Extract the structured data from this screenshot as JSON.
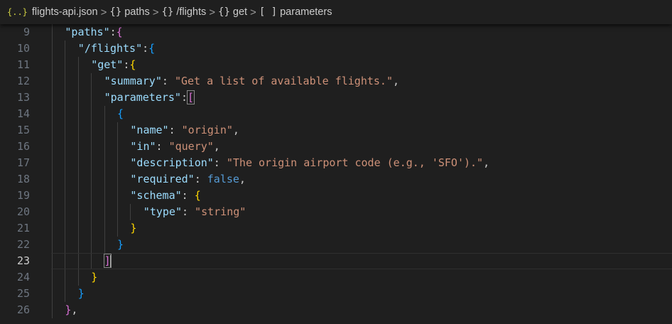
{
  "breadcrumb": [
    {
      "icon": "{..}",
      "icon_name": "json-file-icon",
      "label": "flights-api.json"
    },
    {
      "icon": "{}",
      "icon_name": "object-icon",
      "label": "paths"
    },
    {
      "icon": "{}",
      "icon_name": "object-icon",
      "label": "/flights"
    },
    {
      "icon": "{}",
      "icon_name": "object-icon",
      "label": "get"
    },
    {
      "icon": "[ ]",
      "icon_name": "array-icon",
      "label": "parameters"
    }
  ],
  "breadcrumb_separator": ">",
  "current_line": 23,
  "code": [
    {
      "n": "9",
      "indent": 2,
      "tokens": [
        {
          "t": "\"paths\"",
          "c": "key"
        },
        {
          "t": ":",
          "c": "p"
        },
        {
          "t": "{",
          "c": "b2"
        }
      ]
    },
    {
      "n": "10",
      "indent": 4,
      "tokens": [
        {
          "t": "\"/flights\"",
          "c": "key"
        },
        {
          "t": ":",
          "c": "p"
        },
        {
          "t": "{",
          "c": "b3"
        }
      ]
    },
    {
      "n": "11",
      "indent": 6,
      "tokens": [
        {
          "t": "\"get\"",
          "c": "key"
        },
        {
          "t": ":",
          "c": "p"
        },
        {
          "t": "{",
          "c": "b1"
        }
      ]
    },
    {
      "n": "12",
      "indent": 8,
      "tokens": [
        {
          "t": "\"summary\"",
          "c": "key"
        },
        {
          "t": ": ",
          "c": "p"
        },
        {
          "t": "\"Get a list of available flights.\"",
          "c": "str"
        },
        {
          "t": ",",
          "c": "p"
        }
      ]
    },
    {
      "n": "13",
      "indent": 8,
      "tokens": [
        {
          "t": "\"parameters\"",
          "c": "key"
        },
        {
          "t": ":",
          "c": "p"
        },
        {
          "t": "[",
          "c": "b2 bracket-match"
        }
      ]
    },
    {
      "n": "14",
      "indent": 10,
      "tokens": [
        {
          "t": "{",
          "c": "b3"
        }
      ]
    },
    {
      "n": "15",
      "indent": 12,
      "tokens": [
        {
          "t": "\"name\"",
          "c": "key"
        },
        {
          "t": ": ",
          "c": "p"
        },
        {
          "t": "\"origin\"",
          "c": "str"
        },
        {
          "t": ",",
          "c": "p"
        }
      ]
    },
    {
      "n": "16",
      "indent": 12,
      "tokens": [
        {
          "t": "\"in\"",
          "c": "key"
        },
        {
          "t": ": ",
          "c": "p"
        },
        {
          "t": "\"query\"",
          "c": "str"
        },
        {
          "t": ",",
          "c": "p"
        }
      ]
    },
    {
      "n": "17",
      "indent": 12,
      "tokens": [
        {
          "t": "\"description\"",
          "c": "key"
        },
        {
          "t": ": ",
          "c": "p"
        },
        {
          "t": "\"The origin airport code (e.g., 'SFO').\"",
          "c": "str"
        },
        {
          "t": ",",
          "c": "p"
        }
      ]
    },
    {
      "n": "18",
      "indent": 12,
      "tokens": [
        {
          "t": "\"required\"",
          "c": "key"
        },
        {
          "t": ": ",
          "c": "p"
        },
        {
          "t": "false",
          "c": "kw"
        },
        {
          "t": ",",
          "c": "p"
        }
      ]
    },
    {
      "n": "19",
      "indent": 12,
      "tokens": [
        {
          "t": "\"schema\"",
          "c": "key"
        },
        {
          "t": ": ",
          "c": "p"
        },
        {
          "t": "{",
          "c": "b1"
        }
      ]
    },
    {
      "n": "20",
      "indent": 14,
      "tokens": [
        {
          "t": "\"type\"",
          "c": "key"
        },
        {
          "t": ": ",
          "c": "p"
        },
        {
          "t": "\"string\"",
          "c": "str"
        }
      ]
    },
    {
      "n": "21",
      "indent": 12,
      "tokens": [
        {
          "t": "}",
          "c": "b1"
        }
      ]
    },
    {
      "n": "22",
      "indent": 10,
      "tokens": [
        {
          "t": "}",
          "c": "b3"
        }
      ]
    },
    {
      "n": "23",
      "indent": 8,
      "tokens": [
        {
          "t": "]",
          "c": "b2 bracket-match"
        }
      ]
    },
    {
      "n": "24",
      "indent": 6,
      "tokens": [
        {
          "t": "}",
          "c": "b1"
        }
      ]
    },
    {
      "n": "25",
      "indent": 4,
      "tokens": [
        {
          "t": "}",
          "c": "b3"
        }
      ]
    },
    {
      "n": "26",
      "indent": 2,
      "tokens": [
        {
          "t": "}",
          "c": "b2"
        },
        {
          "t": ",",
          "c": "p"
        }
      ]
    }
  ],
  "colors": {
    "background": "#1f1f1f",
    "key": "#9cdcfe",
    "string": "#ce9178",
    "keyword": "#569cd6",
    "bracket_gold": "#ffd700",
    "bracket_orchid": "#da70d6",
    "bracket_blue": "#179fff",
    "line_number": "#6e7681"
  }
}
